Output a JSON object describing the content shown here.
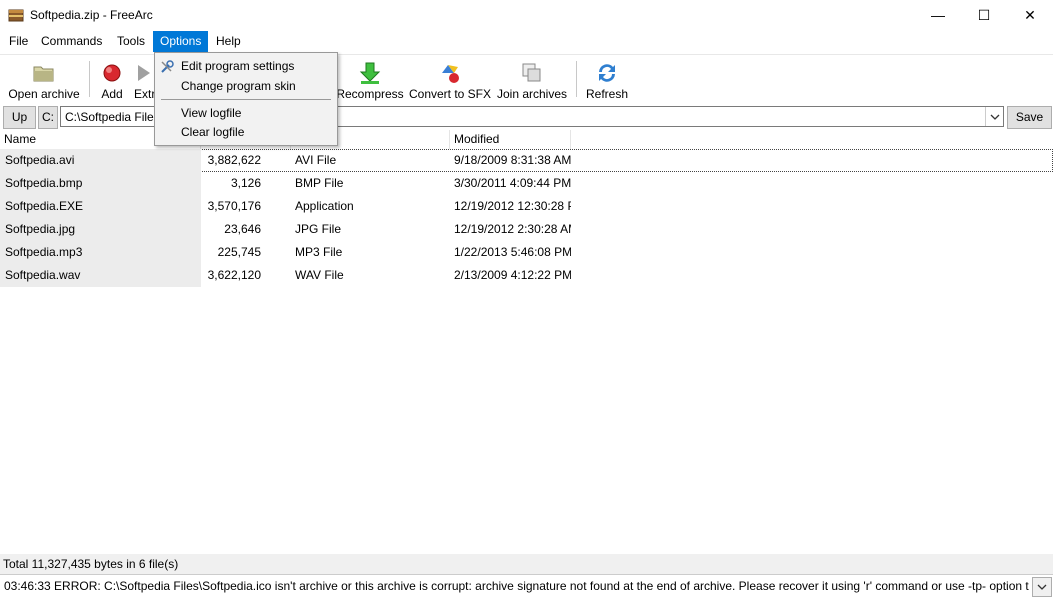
{
  "window": {
    "title": "Softpedia.zip - FreeArc",
    "minimize_glyph": "—",
    "maximize_glyph": "☐",
    "close_glyph": "✕"
  },
  "menu": [
    "File",
    "Commands",
    "Tools",
    "Options",
    "Help"
  ],
  "toolbar": {
    "open_archive": "Open archive",
    "add": "Add",
    "extract": "Extr",
    "recompress": "Recompress",
    "convert_sfx": "Convert to SFX",
    "join_archives": "Join archives",
    "refresh": "Refresh"
  },
  "options_menu": {
    "edit_settings": "Edit program settings",
    "change_skin": "Change program skin",
    "view_logfile": "View logfile",
    "clear_logfile": "Clear logfile"
  },
  "pathbar": {
    "up": "Up",
    "drive": "C:",
    "path": "C:\\Softpedia Files",
    "save": "Save"
  },
  "columns": {
    "name": "Name",
    "type": "ype",
    "modified": "Modified"
  },
  "files": [
    {
      "name": "Softpedia.avi",
      "size": "3,882,622",
      "type": "AVI File",
      "modified": "9/18/2009 8:31:38 AM"
    },
    {
      "name": "Softpedia.bmp",
      "size": "3,126",
      "type": "BMP File",
      "modified": "3/30/2011 4:09:44 PM"
    },
    {
      "name": "Softpedia.EXE",
      "size": "3,570,176",
      "type": "Application",
      "modified": "12/19/2012 12:30:28 PI"
    },
    {
      "name": "Softpedia.jpg",
      "size": "23,646",
      "type": "JPG File",
      "modified": "12/19/2012 2:30:28 AM"
    },
    {
      "name": "Softpedia.mp3",
      "size": "225,745",
      "type": "MP3 File",
      "modified": "1/22/2013 5:46:08 PM"
    },
    {
      "name": "Softpedia.wav",
      "size": "3,622,120",
      "type": "WAV File",
      "modified": "2/13/2009 4:12:22 PM"
    }
  ],
  "status": "Total 11,327,435 bytes in 6 file(s)",
  "log": "03:46:33 ERROR: C:\\Softpedia Files\\Softpedia.ico isn't archive or this archive is corrupt: archive signature not found at the end of archive. Please recover it using 'r' command or use -tp- option to ig",
  "colors": {
    "menu_highlight": "#0078d7",
    "name_column_bg": "#ececec"
  }
}
